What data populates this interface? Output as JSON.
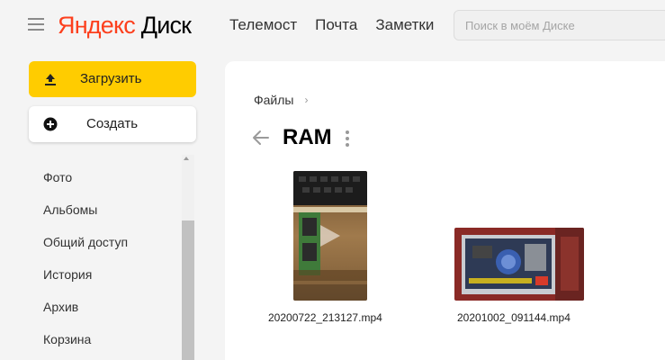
{
  "header": {
    "logo_ya": "Яндекс",
    "logo_disk": "Диск",
    "nav": [
      "Телемост",
      "Почта",
      "Заметки"
    ],
    "search_placeholder": "Поиск в моём Диске"
  },
  "sidebar": {
    "upload_label": "Загрузить",
    "create_label": "Создать",
    "items": [
      "Фото",
      "Альбомы",
      "Общий доступ",
      "История",
      "Архив",
      "Корзина"
    ]
  },
  "main": {
    "breadcrumb": "Файлы",
    "folder_title": "RAM",
    "files": [
      {
        "name": "20200722_213127.mp4",
        "icon": "video-thumbnail-vertical"
      },
      {
        "name": "20201002_091144.mp4",
        "icon": "video-thumbnail-horizontal"
      }
    ]
  },
  "colors": {
    "accent": "#ffcc00",
    "logo_red": "#fc3f1d"
  }
}
